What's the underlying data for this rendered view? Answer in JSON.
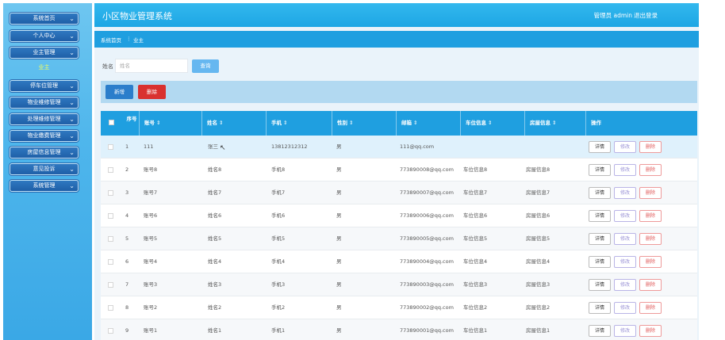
{
  "app": {
    "title": "小区物业管理系统",
    "admin_label": "管理员 admin",
    "logout_label": "退出登录"
  },
  "sidebar": {
    "items": [
      {
        "label": "系统首页"
      },
      {
        "label": "个人中心"
      },
      {
        "label": "业主管理"
      },
      {
        "label": "停车位管理"
      },
      {
        "label": "物业维修管理"
      },
      {
        "label": "处理维修管理"
      },
      {
        "label": "物业缴费管理"
      },
      {
        "label": "房屋信息管理"
      },
      {
        "label": "意见投诉"
      },
      {
        "label": "系统管理"
      }
    ],
    "active_sub": "业主"
  },
  "breadcrumb": {
    "home": "系统首页",
    "separator": "⋮",
    "current": "业主"
  },
  "search": {
    "label": "姓名",
    "placeholder": "姓名",
    "button": "查询"
  },
  "toolbar": {
    "add": "新增",
    "delete": "删除"
  },
  "table": {
    "headers": {
      "no": "序号",
      "account": "账号",
      "name": "姓名",
      "phone": "手机",
      "gender": "性别",
      "email": "邮箱",
      "parking": "车位信息",
      "house": "房屋信息",
      "actions": "操作"
    },
    "sort_glyph": "⇕",
    "action_labels": {
      "detail": "详情",
      "edit": "修改",
      "remove": "删除"
    },
    "rows": [
      {
        "no": "1",
        "account": "111",
        "name": "张三",
        "phone": "13812312312",
        "gender": "男",
        "email": "111@qq.com",
        "parking": "",
        "house": ""
      },
      {
        "no": "2",
        "account": "账号8",
        "name": "姓名8",
        "phone": "手机8",
        "gender": "男",
        "email": "773890008@qq.com",
        "parking": "车位信息8",
        "house": "房屋信息8"
      },
      {
        "no": "3",
        "account": "账号7",
        "name": "姓名7",
        "phone": "手机7",
        "gender": "男",
        "email": "773890007@qq.com",
        "parking": "车位信息7",
        "house": "房屋信息7"
      },
      {
        "no": "4",
        "account": "账号6",
        "name": "姓名6",
        "phone": "手机6",
        "gender": "男",
        "email": "773890006@qq.com",
        "parking": "车位信息6",
        "house": "房屋信息6"
      },
      {
        "no": "5",
        "account": "账号5",
        "name": "姓名5",
        "phone": "手机5",
        "gender": "男",
        "email": "773890005@qq.com",
        "parking": "车位信息5",
        "house": "房屋信息5"
      },
      {
        "no": "6",
        "account": "账号4",
        "name": "姓名4",
        "phone": "手机4",
        "gender": "男",
        "email": "773890004@qq.com",
        "parking": "车位信息4",
        "house": "房屋信息4"
      },
      {
        "no": "7",
        "account": "账号3",
        "name": "姓名3",
        "phone": "手机3",
        "gender": "男",
        "email": "773890003@qq.com",
        "parking": "车位信息3",
        "house": "房屋信息3"
      },
      {
        "no": "8",
        "account": "账号2",
        "name": "姓名2",
        "phone": "手机2",
        "gender": "男",
        "email": "773890002@qq.com",
        "parking": "车位信息2",
        "house": "房屋信息2"
      },
      {
        "no": "9",
        "account": "账号1",
        "name": "姓名1",
        "phone": "手机1",
        "gender": "男",
        "email": "773890001@qq.com",
        "parking": "车位信息1",
        "house": "房屋信息1"
      }
    ]
  },
  "colors": {
    "header": "#1da6e4",
    "sidebar": "#4fb6ec",
    "menu_button": "#1f5fa8",
    "add_button": "#2b7ecb",
    "delete_button": "#d9312f",
    "active_sub": "#f4ff5a"
  }
}
